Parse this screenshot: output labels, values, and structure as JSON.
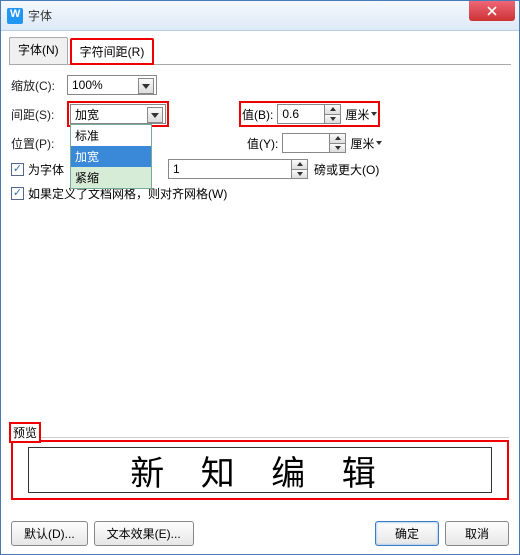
{
  "title": "字体",
  "tabs": {
    "font": "字体(N)",
    "spacing": "字符间距(R)"
  },
  "scale": {
    "label": "缩放(C):",
    "value": "100%"
  },
  "spacing": {
    "label": "间距(S):",
    "value": "加宽",
    "options": {
      "standard": "标准",
      "expanded": "加宽",
      "condensed": "紧缩"
    },
    "val_label": "值(B):",
    "val": "0.6",
    "unit": "厘米"
  },
  "position": {
    "label": "位置(P):",
    "val_label": "值(Y):",
    "val": "",
    "unit": "厘米"
  },
  "kerning": {
    "checkbox": "为字体",
    "val": "1",
    "suffix": "磅或更大(O)"
  },
  "snapgrid": "如果定义了文档网格，则对齐网格(W)",
  "preview": {
    "label": "预览",
    "text": "新 知 编 辑"
  },
  "buttons": {
    "default": "默认(D)...",
    "textfx": "文本效果(E)...",
    "ok": "确定",
    "cancel": "取消"
  }
}
